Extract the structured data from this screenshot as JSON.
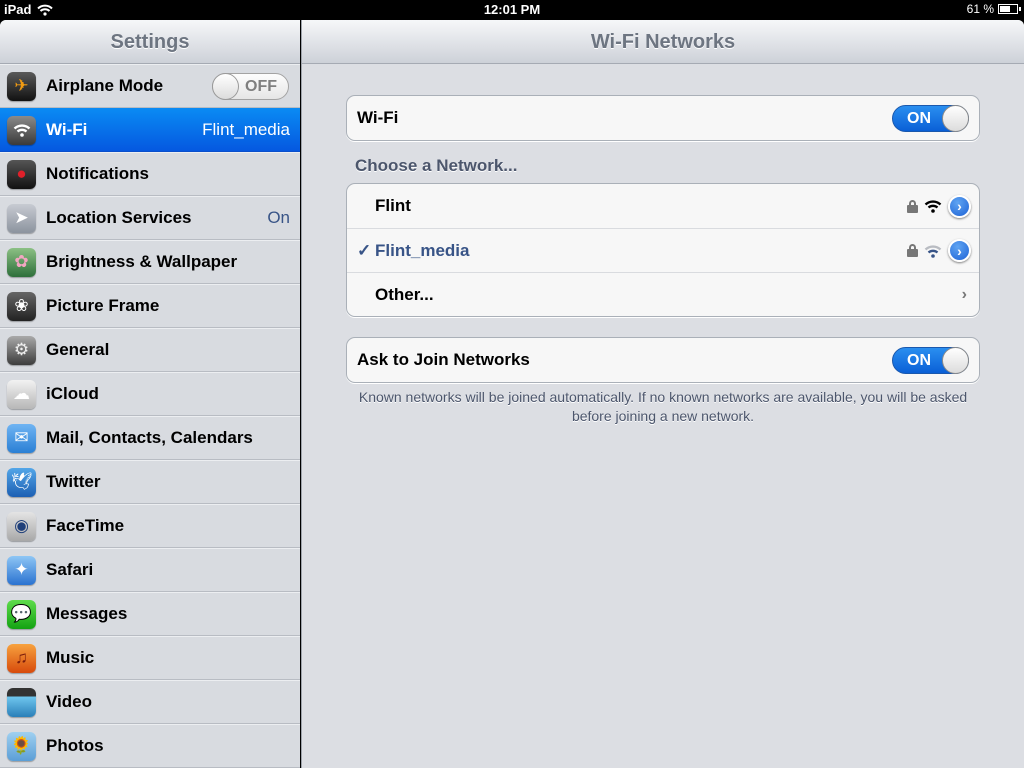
{
  "status_bar": {
    "device": "iPad",
    "time": "12:01 PM",
    "battery_text": "61 %",
    "battery_level": 0.61,
    "wifi_icon": "wifi-icon"
  },
  "sidebar": {
    "title": "Settings",
    "items": [
      {
        "id": "airplane-mode",
        "label": "Airplane Mode",
        "icon": "airplane-icon",
        "toggle": "OFF"
      },
      {
        "id": "wifi",
        "label": "Wi-Fi",
        "icon": "wifi-icon",
        "value": "Flint_media",
        "selected": true
      },
      {
        "id": "notifications",
        "label": "Notifications",
        "icon": "notifications-icon"
      },
      {
        "id": "location-services",
        "label": "Location Services",
        "icon": "location-arrow-icon",
        "value": "On"
      },
      {
        "id": "brightness-wallpaper",
        "label": "Brightness & Wallpaper",
        "icon": "flower-icon"
      },
      {
        "id": "picture-frame",
        "label": "Picture Frame",
        "icon": "picture-frame-icon"
      },
      {
        "id": "general",
        "label": "General",
        "icon": "gear-icon"
      },
      {
        "id": "icloud",
        "label": "iCloud",
        "icon": "cloud-icon"
      },
      {
        "id": "mail-contacts-calendars",
        "label": "Mail, Contacts, Calendars",
        "icon": "mail-icon"
      },
      {
        "id": "twitter",
        "label": "Twitter",
        "icon": "twitter-bird-icon"
      },
      {
        "id": "facetime",
        "label": "FaceTime",
        "icon": "facetime-camera-icon"
      },
      {
        "id": "safari",
        "label": "Safari",
        "icon": "compass-icon"
      },
      {
        "id": "messages",
        "label": "Messages",
        "icon": "speech-bubble-icon"
      },
      {
        "id": "music",
        "label": "Music",
        "icon": "music-note-icon"
      },
      {
        "id": "video",
        "label": "Video",
        "icon": "clapperboard-icon"
      },
      {
        "id": "photos",
        "label": "Photos",
        "icon": "sunflower-icon"
      }
    ]
  },
  "detail": {
    "title": "Wi-Fi Networks",
    "wifi_row": {
      "label": "Wi-Fi",
      "toggle": "ON"
    },
    "networks_header": "Choose a Network...",
    "networks": [
      {
        "name": "Flint",
        "secured": true,
        "signal": "full",
        "connected": false
      },
      {
        "name": "Flint_media",
        "secured": true,
        "signal": "weak",
        "connected": true,
        "check": "✓"
      },
      {
        "name": "Other...",
        "other": true
      }
    ],
    "ask_row": {
      "label": "Ask to Join Networks",
      "toggle": "ON"
    },
    "footer": "Known networks will be joined automatically. If no known networks are available, you will be asked before joining a new network."
  }
}
